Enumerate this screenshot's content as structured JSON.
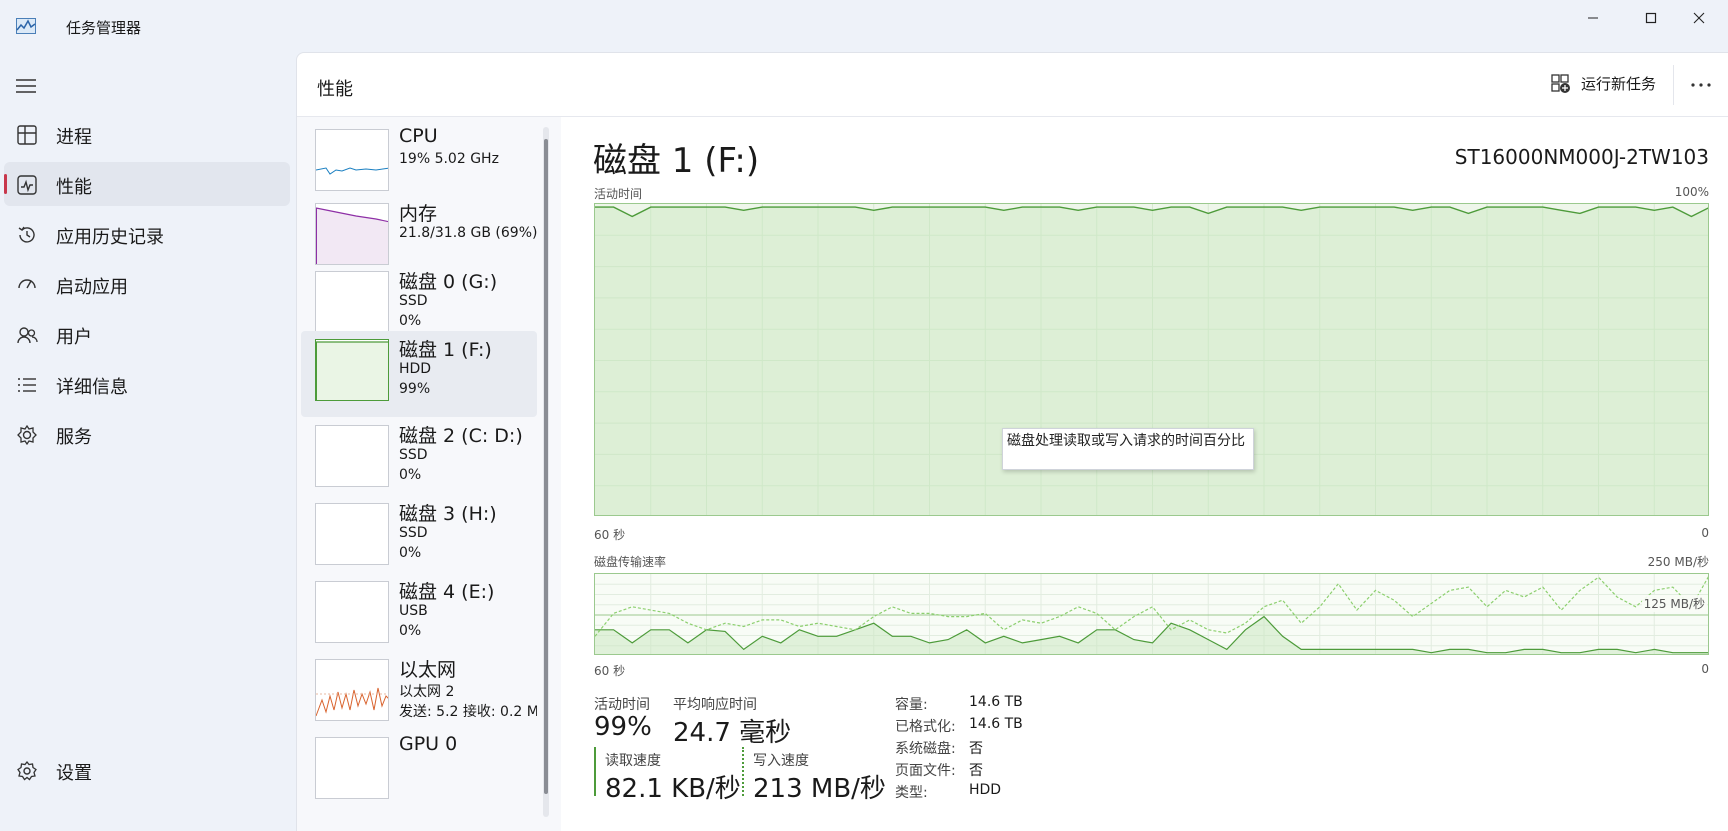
{
  "window": {
    "title": "任务管理器",
    "controls": {
      "minimize": "minimize-icon",
      "maximize": "maximize-icon",
      "close": "close-icon"
    }
  },
  "nav": {
    "items": [
      {
        "label": "进程",
        "icon": "processes-icon"
      },
      {
        "label": "性能",
        "icon": "performance-icon",
        "active": true
      },
      {
        "label": "应用历史记录",
        "icon": "app-history-icon"
      },
      {
        "label": "启动应用",
        "icon": "startup-apps-icon"
      },
      {
        "label": "用户",
        "icon": "users-icon"
      },
      {
        "label": "详细信息",
        "icon": "details-icon"
      },
      {
        "label": "服务",
        "icon": "services-icon"
      }
    ],
    "settings": {
      "label": "设置",
      "icon": "settings-gear-icon"
    }
  },
  "header": {
    "title": "性能",
    "run_task_label": "运行新任务"
  },
  "devices": [
    {
      "name": "CPU",
      "sub1": "19%  5.02 GHz",
      "sub2": "",
      "color": "#1a7fc1"
    },
    {
      "name": "内存",
      "sub1": "21.8/31.8 GB (69%)",
      "sub2": "",
      "color": "#8e2fa6"
    },
    {
      "name": "磁盘 0 (G:)",
      "sub1": "SSD",
      "sub2": "0%",
      "color": "#4d9b3a"
    },
    {
      "name": "磁盘 1 (F:)",
      "sub1": "HDD",
      "sub2": "99%",
      "color": "#4d9b3a",
      "active": true
    },
    {
      "name": "磁盘 2 (C: D:)",
      "sub1": "SSD",
      "sub2": "0%",
      "color": "#4d9b3a"
    },
    {
      "name": "磁盘 3 (H:)",
      "sub1": "SSD",
      "sub2": "0%",
      "color": "#4d9b3a"
    },
    {
      "name": "磁盘 4 (E:)",
      "sub1": "USB",
      "sub2": "0%",
      "color": "#4d9b3a"
    },
    {
      "name": "以太网",
      "sub1": "以太网 2",
      "sub2": "发送: 5.2  接收: 0.2 M",
      "color": "#d9632e"
    },
    {
      "name": "GPU 0",
      "sub1": "",
      "sub2": "",
      "color": "#1a7fc1"
    }
  ],
  "detail": {
    "title": "磁盘 1 (F:)",
    "model": "ST16000NM000J-2TW103",
    "activity_label": "活动时间",
    "activity_max": "100%",
    "x_left": "60 秒",
    "x_right": "0",
    "tooltip": "磁盘处理读取或写入请求的时间百分比",
    "transfer_label": "磁盘传输速率",
    "transfer_max": "250 MB/秒",
    "transfer_mid": "125 MB/秒",
    "stats": {
      "active_label": "活动时间",
      "active_value": "99%",
      "resp_label": "平均响应时间",
      "resp_value": "24.7 毫秒",
      "read_label": "读取速度",
      "read_value": "82.1 KB/秒",
      "write_label": "写入速度",
      "write_value": "213 MB/秒"
    },
    "props": [
      {
        "k": "容量:",
        "v": "14.6 TB"
      },
      {
        "k": "已格式化:",
        "v": "14.6 TB"
      },
      {
        "k": "系统磁盘:",
        "v": "否"
      },
      {
        "k": "页面文件:",
        "v": "否"
      },
      {
        "k": "类型:",
        "v": "HDD"
      }
    ]
  },
  "chart_data": [
    {
      "type": "area",
      "title": "活动时间",
      "xlabel": "",
      "ylabel": "",
      "x_range": [
        "60 秒",
        "0"
      ],
      "ylim": [
        0,
        100
      ],
      "grid": true,
      "series": [
        {
          "values": [
            99,
            99,
            96,
            99,
            99,
            99,
            99,
            99,
            98,
            99,
            99,
            99,
            99,
            99,
            99,
            98,
            99,
            99,
            99,
            99,
            99,
            99,
            98,
            99,
            99,
            99,
            98,
            99,
            99,
            99,
            98,
            99,
            99,
            97,
            99,
            99,
            99,
            99,
            98,
            99,
            99,
            99,
            99,
            99,
            98,
            99,
            99,
            97,
            99,
            99,
            99,
            99,
            98,
            97,
            99,
            99,
            99,
            98,
            99,
            96,
            99
          ]
        }
      ]
    },
    {
      "type": "line",
      "title": "磁盘传输速率",
      "xlabel": "",
      "ylabel": "",
      "x_range": [
        "60 秒",
        "0"
      ],
      "ylim": [
        0,
        250
      ],
      "ytick_mid": "125 MB/秒",
      "grid": true,
      "series": [
        {
          "style": "solid",
          "values": [
            80,
            80,
            40,
            80,
            80,
            40,
            80,
            75,
            20,
            60,
            40,
            80,
            60,
            60,
            80,
            100,
            60,
            60,
            40,
            50,
            80,
            40,
            60,
            40,
            50,
            60,
            40,
            80,
            80,
            50,
            40,
            100,
            80,
            50,
            20,
            80,
            120,
            60,
            20,
            20,
            20,
            20,
            20,
            20,
            20,
            10,
            20,
            20,
            10,
            10,
            20,
            20,
            10,
            10,
            20,
            20,
            10,
            20,
            10,
            10,
            10
          ]
        },
        {
          "style": "dashed",
          "values": [
            60,
            130,
            150,
            140,
            130,
            100,
            80,
            100,
            90,
            110,
            110,
            90,
            100,
            90,
            80,
            120,
            150,
            130,
            130,
            120,
            120,
            130,
            80,
            110,
            100,
            120,
            150,
            130,
            80,
            120,
            150,
            80,
            110,
            80,
            70,
            100,
            150,
            170,
            100,
            150,
            220,
            140,
            200,
            170,
            120,
            160,
            200,
            210,
            150,
            200,
            180,
            210,
            140,
            200,
            240,
            180,
            150,
            200,
            210,
            150,
            250
          ]
        }
      ]
    }
  ]
}
